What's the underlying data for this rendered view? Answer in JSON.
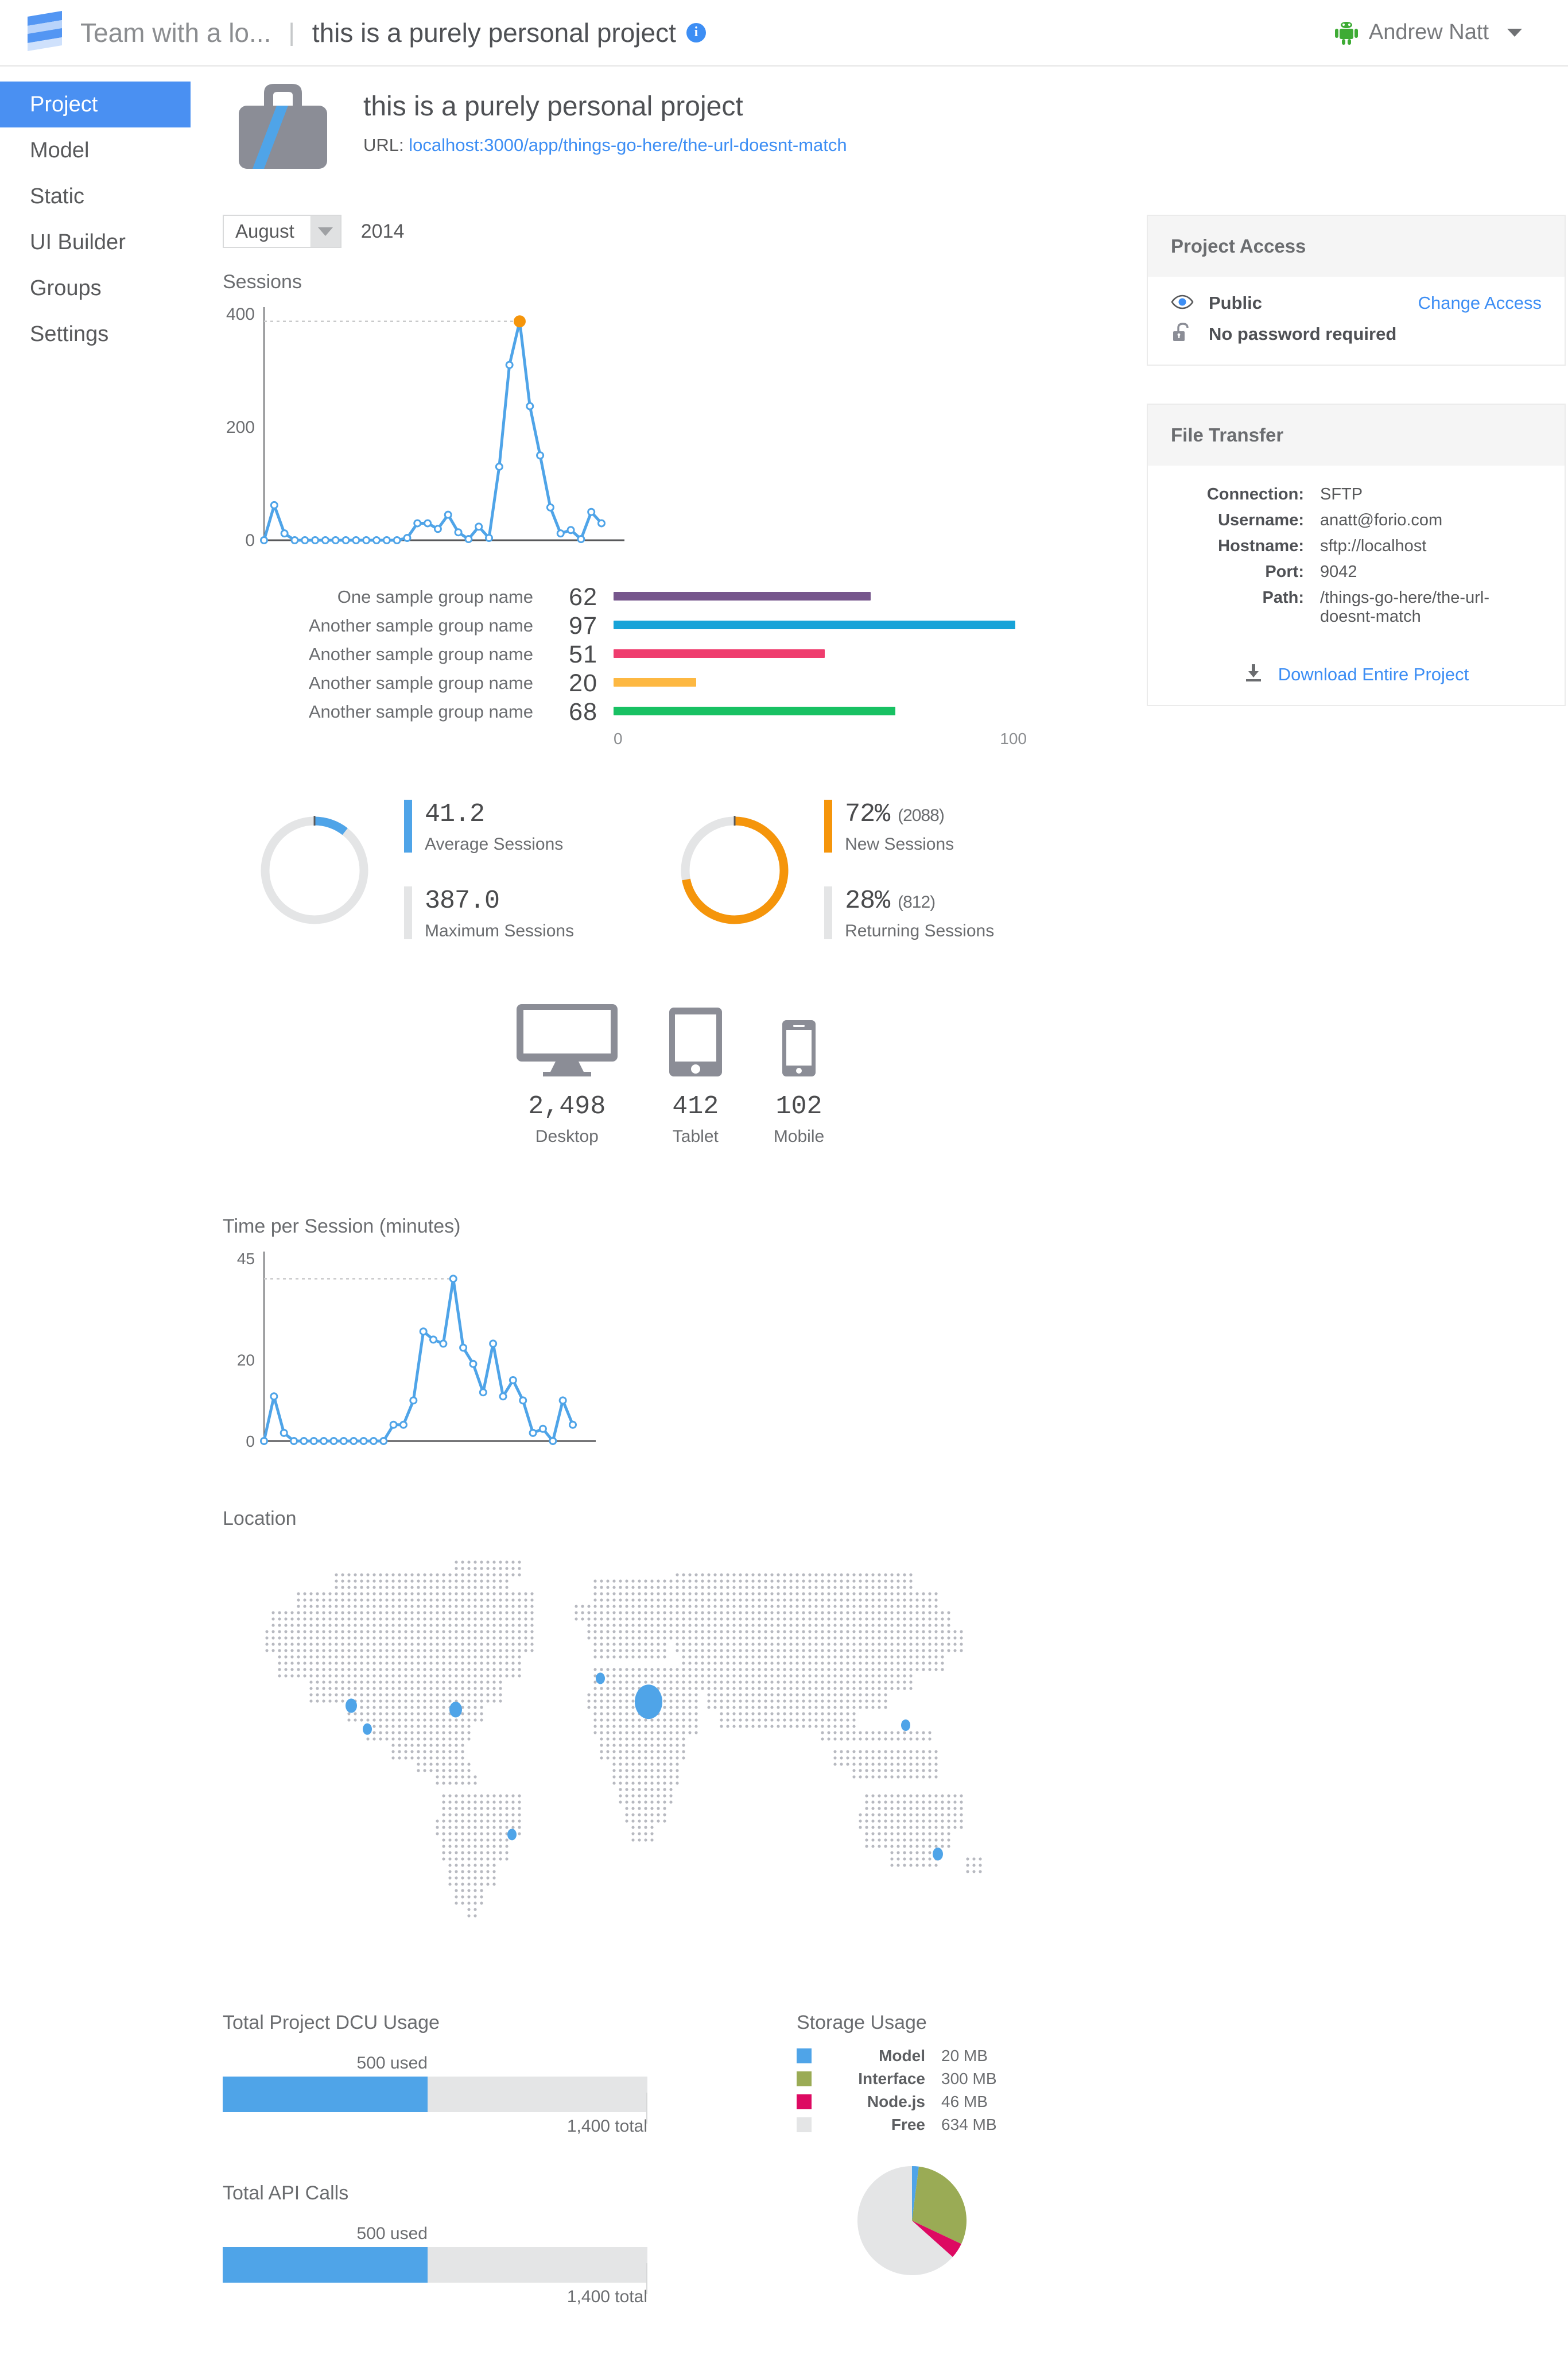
{
  "topbar": {
    "team_name": "Team with a lo...",
    "separator": "|",
    "project_name": "this is a purely personal project",
    "info_glyph": "i",
    "user_name": "Andrew Natt"
  },
  "sidebar": {
    "items": [
      {
        "label": "Project",
        "active": true
      },
      {
        "label": "Model",
        "active": false
      },
      {
        "label": "Static",
        "active": false
      },
      {
        "label": "UI Builder",
        "active": false
      },
      {
        "label": "Groups",
        "active": false
      },
      {
        "label": "Settings",
        "active": false
      }
    ]
  },
  "project": {
    "title": "this is a purely personal project",
    "url_label": "URL:",
    "url": "localhost:3000/app/things-go-here/the-url-doesnt-match"
  },
  "filters": {
    "month": "August",
    "year": "2014"
  },
  "sections": {
    "sessions": "Sessions",
    "time_per_session": "Time per Session (minutes)",
    "location": "Location",
    "dcu_usage": "Total Project DCU Usage",
    "api_calls": "Total API Calls",
    "storage_usage": "Storage Usage"
  },
  "donuts": {
    "left": {
      "primary_value": "41.2",
      "primary_label": "Average Sessions",
      "secondary_value": "387.0",
      "secondary_label": "Maximum Sessions",
      "accent": "#4fa4e8",
      "fraction": 0.106
    },
    "right": {
      "primary_value": "72%",
      "primary_paren": "(2088)",
      "primary_label": "New Sessions",
      "secondary_value": "28%",
      "secondary_paren": "(812)",
      "secondary_label": "Returning Sessions",
      "accent": "#f5950b",
      "fraction": 0.72
    }
  },
  "devices": [
    {
      "icon": "desktop-icon",
      "count": "2,498",
      "label": "Desktop"
    },
    {
      "icon": "tablet-icon",
      "count": "412",
      "label": "Tablet"
    },
    {
      "icon": "mobile-icon",
      "count": "102",
      "label": "Mobile"
    }
  ],
  "usage": {
    "dcu": {
      "title": "Total Project DCU Usage",
      "used_label": "500 used",
      "total_label": "1,400 total",
      "used": 500,
      "total": 1400
    },
    "api": {
      "title": "Total API Calls",
      "used_label": "500 used",
      "total_label": "1,400 total",
      "used": 500,
      "total": 1400
    }
  },
  "project_access": {
    "heading": "Project Access",
    "visibility": "Public",
    "password": "No password required",
    "change_link": "Change Access"
  },
  "file_transfer": {
    "heading": "File Transfer",
    "rows": [
      {
        "key": "Connection:",
        "value": "SFTP"
      },
      {
        "key": "Username:",
        "value": "anatt@forio.com"
      },
      {
        "key": "Hostname:",
        "value": "sftp://localhost"
      },
      {
        "key": "Port:",
        "value": "9042"
      },
      {
        "key": "Path:",
        "value": "/things-go-here/the-url-doesnt-match"
      }
    ],
    "download_label": "Download Entire Project"
  },
  "chart_data": [
    {
      "type": "line",
      "name": "sessions",
      "title": "Sessions",
      "xlabel": "",
      "ylabel": "",
      "ylim": [
        0,
        400
      ],
      "yticks": [
        0,
        200,
        400
      ],
      "grid": false,
      "annotation_line": 387,
      "highlight_index": 22,
      "highlight_color": "#f5950b",
      "line_color": "#4fa4e8",
      "x": [
        1,
        2,
        3,
        4,
        5,
        6,
        7,
        8,
        9,
        10,
        11,
        12,
        13,
        14,
        15,
        16,
        17,
        18,
        19,
        20,
        21,
        22,
        23,
        24,
        25,
        26,
        27,
        28,
        29,
        30,
        31
      ],
      "values": [
        0,
        62,
        12,
        0,
        0,
        0,
        0,
        0,
        0,
        0,
        0,
        0,
        0,
        0,
        4,
        30,
        30,
        20,
        45,
        14,
        2,
        24,
        4,
        130,
        310,
        387,
        237,
        150,
        58,
        12,
        18,
        2,
        50,
        30
      ]
    },
    {
      "type": "bar",
      "name": "group-sessions",
      "orientation": "horizontal",
      "xlim": [
        0,
        100
      ],
      "xticks": [
        0,
        100
      ],
      "xtick_labels": [
        "0",
        "100"
      ],
      "categories": [
        "One sample group name",
        "Another sample group name",
        "Another sample group name",
        "Another sample group name",
        "Another sample group name"
      ],
      "values": [
        62,
        97,
        51,
        20,
        68
      ],
      "colors": [
        "#76568c",
        "#17a3d8",
        "#ef3d6e",
        "#fdb842",
        "#18c163"
      ]
    },
    {
      "type": "line",
      "name": "time-per-session",
      "title": "Time per Session (minutes)",
      "ylim": [
        0,
        45
      ],
      "yticks": [
        0,
        20,
        45
      ],
      "grid": false,
      "annotation_line": 40,
      "line_color": "#4fa4e8",
      "x": [
        1,
        2,
        3,
        4,
        5,
        6,
        7,
        8,
        9,
        10,
        11,
        12,
        13,
        14,
        15,
        16,
        17,
        18,
        19,
        20,
        21,
        22,
        23,
        24,
        25,
        26,
        27,
        28,
        29,
        30,
        31,
        32,
        33,
        34
      ],
      "values": [
        0,
        11,
        2,
        0,
        0,
        0,
        0,
        0,
        0,
        0,
        0,
        0,
        0,
        4,
        4,
        10,
        27,
        25,
        24,
        40,
        23,
        19,
        12,
        24,
        11,
        15,
        10,
        2,
        3,
        0,
        10,
        4
      ]
    },
    {
      "type": "scatter",
      "name": "location-map",
      "title": "Location",
      "points": [
        {
          "x": 0.16,
          "y": 0.4,
          "r": 10
        },
        {
          "x": 0.18,
          "y": 0.46,
          "r": 8
        },
        {
          "x": 0.29,
          "y": 0.41,
          "r": 11
        },
        {
          "x": 0.47,
          "y": 0.33,
          "r": 8
        },
        {
          "x": 0.53,
          "y": 0.39,
          "r": 24
        },
        {
          "x": 0.85,
          "y": 0.45,
          "r": 8
        },
        {
          "x": 0.36,
          "y": 0.73,
          "r": 8
        },
        {
          "x": 0.89,
          "y": 0.78,
          "r": 9
        }
      ]
    },
    {
      "type": "pie",
      "name": "storage-usage",
      "title": "Storage Usage",
      "labels": [
        "Model",
        "Interface",
        "Node.js",
        "Free"
      ],
      "values": [
        20,
        300,
        46,
        634
      ],
      "value_labels": [
        "20 MB",
        "300 MB",
        "46 MB",
        "634 MB"
      ],
      "colors": [
        "#4fa4e8",
        "#9aab55",
        "#dd0a62",
        "#e4e5e6"
      ]
    }
  ]
}
